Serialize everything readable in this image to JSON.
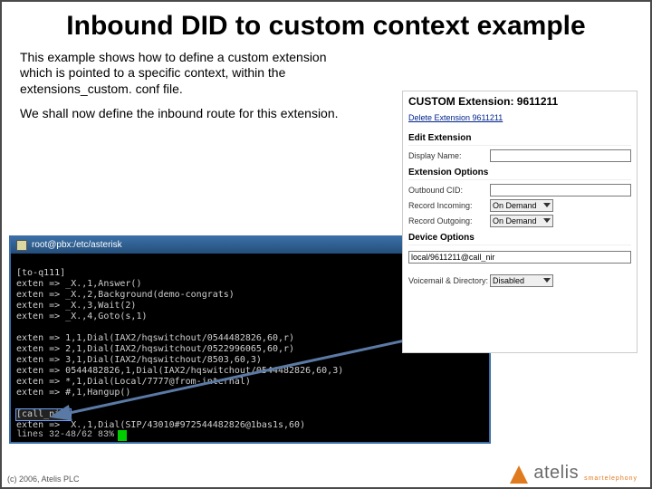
{
  "title": "Inbound DID to custom context example",
  "paragraphs": [
    "This example shows how to define a custom extension which is pointed to a specific context, within the extensions_custom. conf file.",
    "We shall now define the inbound route for this extension."
  ],
  "terminal": {
    "title": "root@pbx:/etc/asterisk",
    "lines": [
      "",
      "[to-q111]",
      "exten => _X.,1,Answer()",
      "exten => _X.,2,Background(demo-congrats)",
      "exten => _X.,3,Wait(2)",
      "exten => _X.,4,Goto(s,1)",
      "",
      "exten => 1,1,Dial(IAX2/hqswitchout/0544482826,60,r)",
      "exten => 2,1,Dial(IAX2/hqswitchout/0522996065,60,r)",
      "exten => 3,1,Dial(IAX2/hqswitchout/8503,60,3)",
      "exten => 0544482826,1,Dial(IAX2/hqswitchout/0544482826,60,3)",
      "exten => *,1,Dial(Local/7777@from-internal)",
      "exten => #,1,Hangup()",
      ""
    ],
    "highlighted_section": "[call_nir]",
    "highlighted_line": "exten => _X.,1,Dial(SIP/43010#972544482826@1bas1s,60)",
    "status": "lines 32-48/62 83%"
  },
  "webform": {
    "heading": "CUSTOM Extension: 9611211",
    "delete_link": "Delete Extension 9611211",
    "sections": {
      "edit": "Edit Extension",
      "ext_opts": "Extension Options",
      "dev_opts": "Device Options",
      "vm": "Voicemail & Directory:"
    },
    "fields": {
      "display_name_label": "Display Name:",
      "display_name_value": "",
      "outbound_cid_label": "Outbound CID:",
      "outbound_cid_value": "",
      "rec_in_label": "Record Incoming:",
      "rec_in_value": "On Demand",
      "rec_out_label": "Record Outgoing:",
      "rec_out_value": "On Demand",
      "dial_value": "local/9611211@call_nir",
      "vm_value": "Disabled"
    }
  },
  "footer": {
    "copyright": "(c) 2006, Atelis PLC",
    "brand": "atelis",
    "tagline": "smartelephony"
  }
}
